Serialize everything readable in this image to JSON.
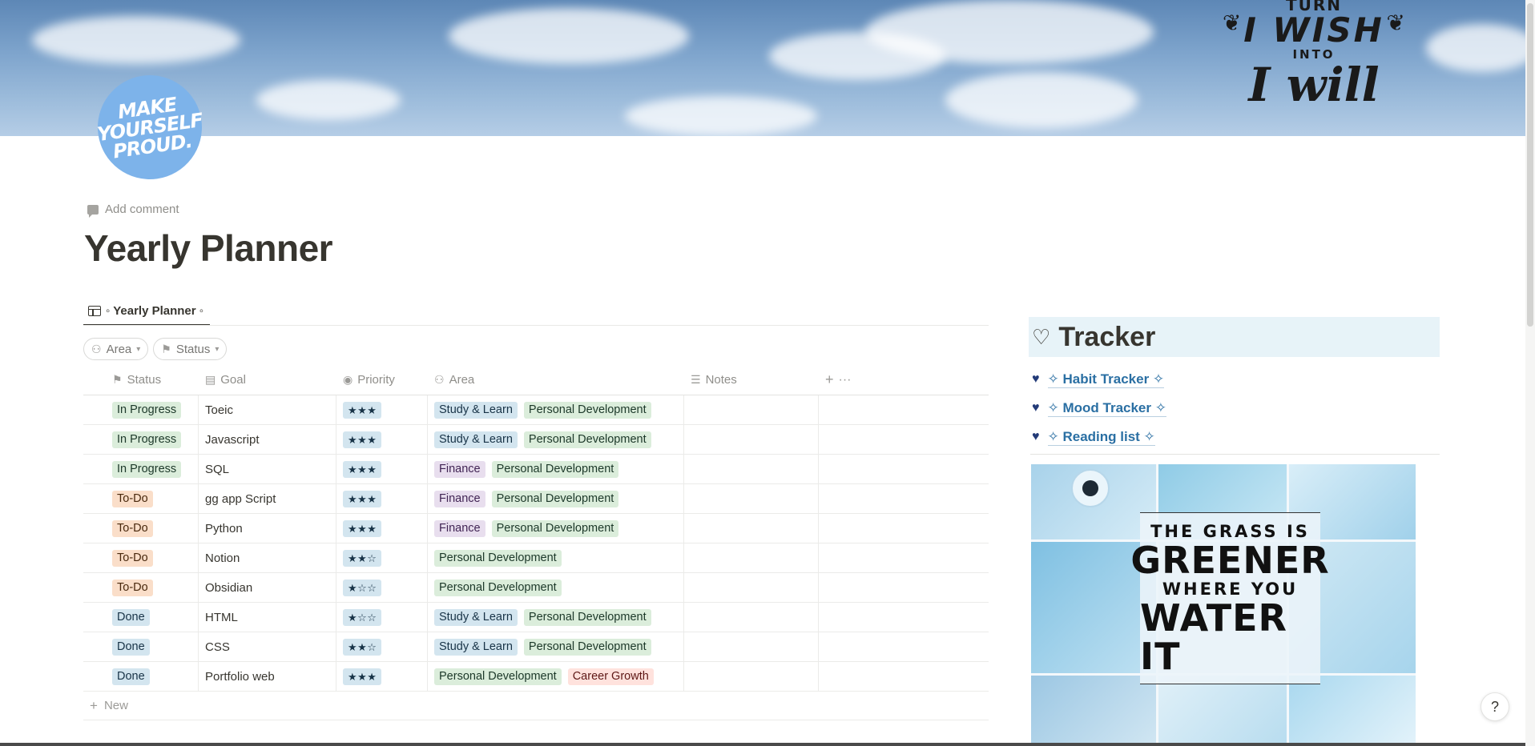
{
  "cover": {
    "quote_line1": "TURN",
    "quote_line2": "I WISH",
    "quote_line3": "INTO",
    "quote_line4": "I will"
  },
  "page_icon": {
    "line1": "MAKE",
    "line2": "YOURSELF",
    "line3": "PROUD."
  },
  "add_comment_label": "Add comment",
  "page_title": "Yearly Planner",
  "view_tab_label": "◦ Yearly Planner ◦",
  "filters": [
    {
      "label": "Area",
      "icon": "area-icon"
    },
    {
      "label": "Status",
      "icon": "flag-icon"
    }
  ],
  "table": {
    "columns": {
      "status": "Status",
      "goal": "Goal",
      "priority": "Priority",
      "area": "Area",
      "notes": "Notes"
    },
    "rows": [
      {
        "status": "In Progress",
        "goal": "Toeic",
        "priority": "★★★",
        "areas": [
          "Study & Learn",
          "Personal Development"
        ]
      },
      {
        "status": "In Progress",
        "goal": "Javascript",
        "priority": "★★★",
        "areas": [
          "Study & Learn",
          "Personal Development"
        ]
      },
      {
        "status": "In Progress",
        "goal": "SQL",
        "priority": "★★★",
        "areas": [
          "Finance",
          "Personal Development"
        ]
      },
      {
        "status": "To-Do",
        "goal": "gg app Script",
        "priority": "★★★",
        "areas": [
          "Finance",
          "Personal Development"
        ]
      },
      {
        "status": "To-Do",
        "goal": "Python",
        "priority": "★★★",
        "areas": [
          "Finance",
          "Personal Development"
        ]
      },
      {
        "status": "To-Do",
        "goal": "Notion",
        "priority": "★★☆",
        "areas": [
          "Personal Development"
        ]
      },
      {
        "status": "To-Do",
        "goal": "Obsidian",
        "priority": "★☆☆",
        "areas": [
          "Personal Development"
        ]
      },
      {
        "status": "Done",
        "goal": "HTML",
        "priority": "★☆☆",
        "areas": [
          "Study & Learn",
          "Personal Development"
        ]
      },
      {
        "status": "Done",
        "goal": "CSS",
        "priority": "★★☆",
        "areas": [
          "Study & Learn",
          "Personal Development"
        ]
      },
      {
        "status": "Done",
        "goal": "Portfolio web",
        "priority": "★★★",
        "areas": [
          "Personal Development",
          "Career Growth"
        ]
      }
    ],
    "new_label": "New",
    "add_symbol": "+",
    "more_symbol": "···"
  },
  "tag_colors": {
    "In Progress": "green",
    "To-Do": "orange",
    "Done": "blue",
    "Study & Learn": "blue",
    "Personal Development": "green",
    "Finance": "purple",
    "Career Growth": "red"
  },
  "tracker": {
    "heading": "Tracker",
    "heading_icon": "♡",
    "links": [
      {
        "label": "✧ Habit Tracker ✧"
      },
      {
        "label": "✧ Mood Tracker ✧"
      },
      {
        "label": "✧ Reading list ✧"
      }
    ]
  },
  "collage_quote": {
    "line1": "THE GRASS IS",
    "line2": "GREENER",
    "line3": "WHERE YOU",
    "line4": "WATER IT"
  },
  "help_label": "?"
}
